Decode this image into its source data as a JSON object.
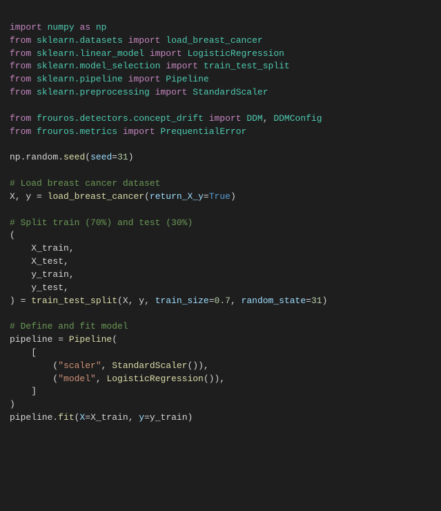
{
  "lines": [
    "<span class='kw'>import</span> <span class='mod'>numpy</span> <span class='kw'>as</span> <span class='mod'>np</span>",
    "<span class='kw'>from</span> <span class='mod'>sklearn.datasets</span> <span class='kw'>import</span> <span class='mod'>load_breast_cancer</span>",
    "<span class='kw'>from</span> <span class='mod'>sklearn.linear_model</span> <span class='kw'>import</span> <span class='mod'>LogisticRegression</span>",
    "<span class='kw'>from</span> <span class='mod'>sklearn.model_selection</span> <span class='kw'>import</span> <span class='mod'>train_test_split</span>",
    "<span class='kw'>from</span> <span class='mod'>sklearn.pipeline</span> <span class='kw'>import</span> <span class='mod'>Pipeline</span>",
    "<span class='kw'>from</span> <span class='mod'>sklearn.preprocessing</span> <span class='kw'>import</span> <span class='mod'>StandardScaler</span>",
    "",
    "<span class='kw'>from</span> <span class='mod'>frouros.detectors.concept_drift</span> <span class='kw'>import</span> <span class='mod'>DDM</span>, <span class='mod'>DDMConfig</span>",
    "<span class='kw'>from</span> <span class='mod'>frouros.metrics</span> <span class='kw'>import</span> <span class='mod'>PrequentialError</span>",
    "",
    "<span class='id'>np</span>.<span class='id'>random</span>.<span class='fn'>seed</span>(<span class='param'>seed</span>=<span class='num'>31</span>)",
    "",
    "<span class='comment'># Load breast cancer dataset</span>",
    "<span class='id'>X</span>, <span class='id'>y</span> = <span class='fn'>load_breast_cancer</span>(<span class='param'>return_X_y</span>=<span class='const'>True</span>)",
    "",
    "<span class='comment'># Split train (70%) and test (30%)</span>",
    "(",
    "    <span class='id'>X_train</span>,",
    "    <span class='id'>X_test</span>,",
    "    <span class='id'>y_train</span>,",
    "    <span class='id'>y_test</span>,",
    ") = <span class='fn'>train_test_split</span>(<span class='id'>X</span>, <span class='id'>y</span>, <span class='param'>train_size</span>=<span class='num'>0.7</span>, <span class='param'>random_state</span>=<span class='num'>31</span>)",
    "",
    "<span class='comment'># Define and fit model</span>",
    "<span class='id'>pipeline</span> = <span class='fn'>Pipeline</span>(",
    "    [",
    "        (<span class='str'>\"scaler\"</span>, <span class='fn'>StandardScaler</span>()),",
    "        (<span class='str'>\"model\"</span>, <span class='fn'>LogisticRegression</span>()),",
    "    ]",
    ")",
    "<span class='id'>pipeline</span>.<span class='fn'>fit</span>(<span class='param'>X</span>=<span class='id'>X_train</span>, <span class='param'>y</span>=<span class='id'>y_train</span>)"
  ]
}
